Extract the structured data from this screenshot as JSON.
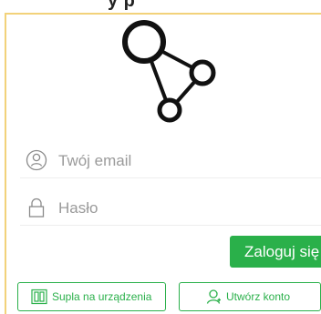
{
  "header": {
    "tab_fragment": "y p"
  },
  "login_form": {
    "email_placeholder": "Twój email",
    "password_placeholder": "Hasło",
    "login_label": "Zaloguj się"
  },
  "footer_actions": {
    "pair_label": "Supla na urządzenia",
    "create_label": "Utwórz konto"
  },
  "colors": {
    "accent": "#2ab04a",
    "frame_border": "#f2d27a",
    "placeholder": "#9a9a9a"
  },
  "icons": {
    "logo": "supla-logo",
    "email": "user-icon",
    "password": "lock-icon",
    "pair": "devices-icon",
    "create": "add-user-icon"
  }
}
